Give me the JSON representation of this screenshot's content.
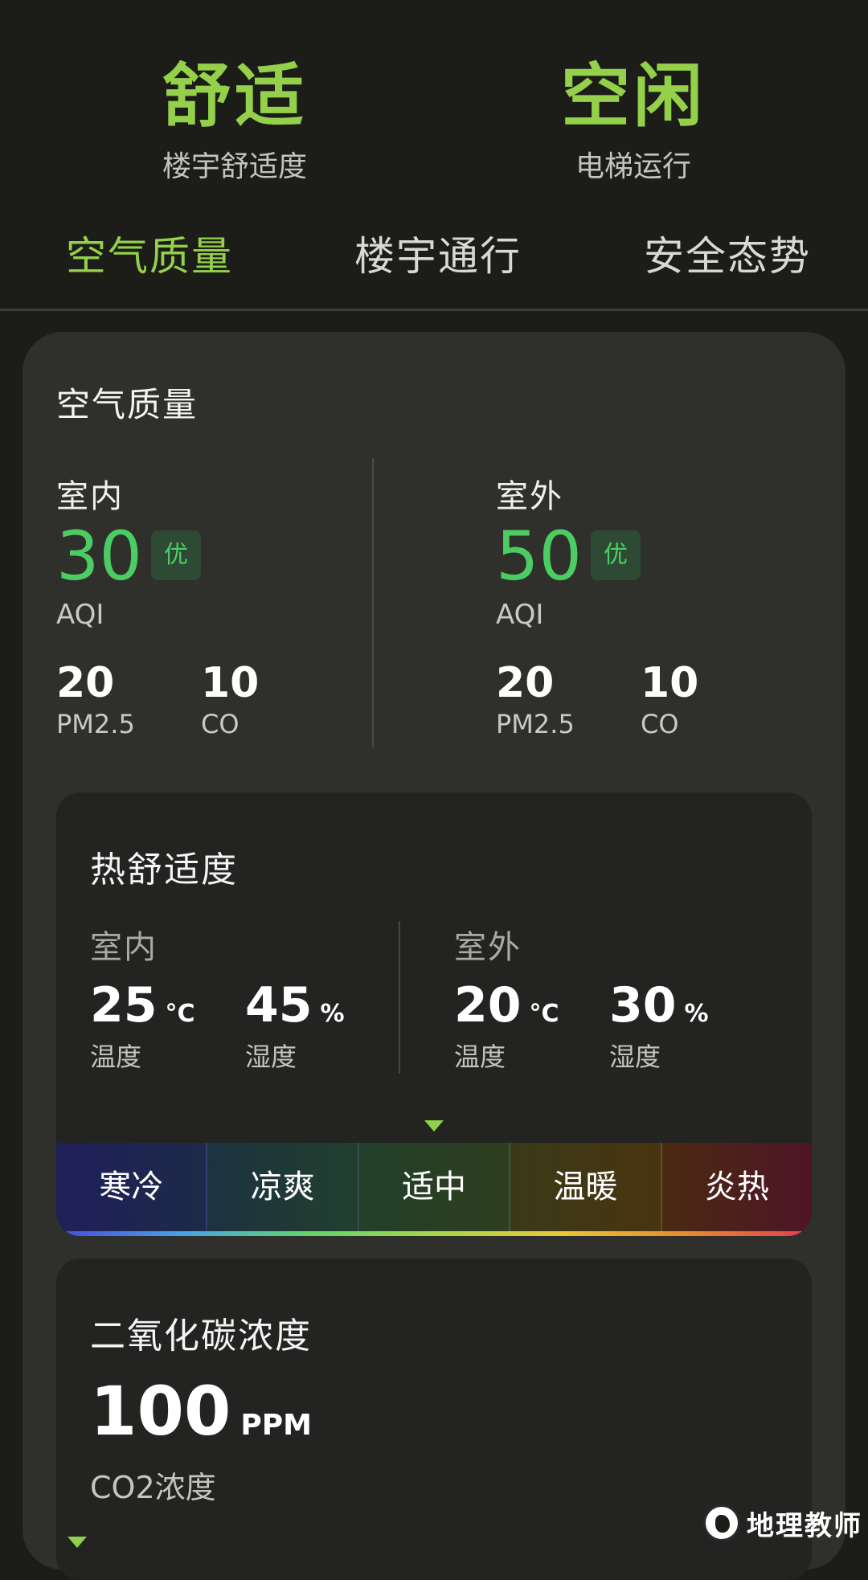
{
  "header": {
    "comfort": {
      "value": "舒适",
      "label": "楼宇舒适度"
    },
    "elevator": {
      "value": "空闲",
      "label": "电梯运行"
    }
  },
  "tabs": [
    {
      "label": "空气质量",
      "active": true
    },
    {
      "label": "楼宇通行",
      "active": false
    },
    {
      "label": "安全态势",
      "active": false
    }
  ],
  "air_quality": {
    "title": "空气质量",
    "indoor": {
      "label": "室内",
      "aqi": "30",
      "grade": "优",
      "aqi_label": "AQI",
      "pm25": "20",
      "pm25_label": "PM2.5",
      "co": "10",
      "co_label": "CO"
    },
    "outdoor": {
      "label": "室外",
      "aqi": "50",
      "grade": "优",
      "aqi_label": "AQI",
      "pm25": "20",
      "pm25_label": "PM2.5",
      "co": "10",
      "co_label": "CO"
    }
  },
  "thermal": {
    "title": "热舒适度",
    "indoor": {
      "label": "室内",
      "temp": "25",
      "temp_unit": "°C",
      "temp_label": "温度",
      "humidity": "45",
      "humidity_unit": "%",
      "humidity_label": "湿度"
    },
    "outdoor": {
      "label": "室外",
      "temp": "20",
      "temp_unit": "°C",
      "temp_label": "温度",
      "humidity": "30",
      "humidity_unit": "%",
      "humidity_label": "湿度"
    },
    "scale": [
      "寒冷",
      "凉爽",
      "适中",
      "温暖",
      "炎热"
    ],
    "current_level": "适中"
  },
  "co2": {
    "title": "二氧化碳浓度",
    "value": "100",
    "unit": "PPM",
    "label": "CO2浓度"
  },
  "watermark": {
    "text": "地理教师"
  },
  "colors": {
    "accent": "#94d04a",
    "good": "#4ccd64",
    "background": "#1c1d19",
    "card": "#2f302c"
  }
}
